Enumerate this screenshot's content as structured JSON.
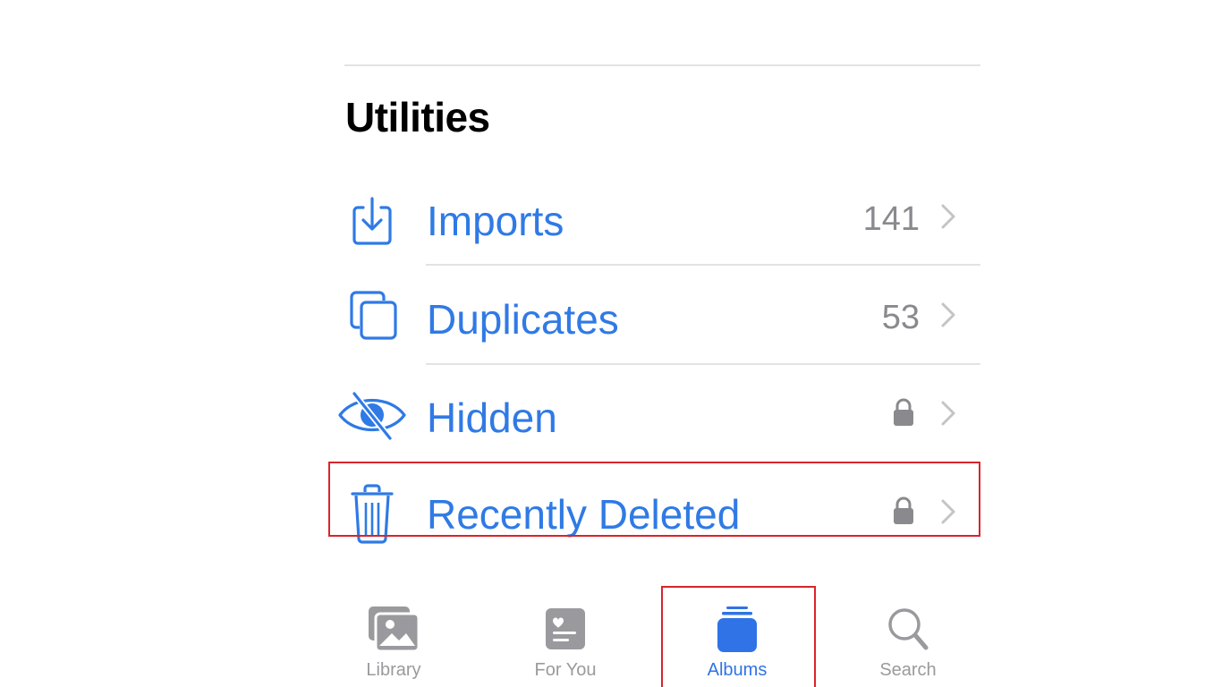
{
  "section": {
    "title": "Utilities"
  },
  "rows": [
    {
      "label": "Imports",
      "icon": "import-icon",
      "count": "141",
      "locked": false
    },
    {
      "label": "Duplicates",
      "icon": "duplicates-icon",
      "count": "53",
      "locked": false
    },
    {
      "label": "Hidden",
      "icon": "eye-slash-icon",
      "count": null,
      "locked": true
    },
    {
      "label": "Recently Deleted",
      "icon": "trash-icon",
      "count": null,
      "locked": true
    }
  ],
  "tabbar": {
    "tabs": [
      {
        "label": "Library",
        "icon": "photo-library-icon",
        "active": false
      },
      {
        "label": "For You",
        "icon": "for-you-icon",
        "active": false
      },
      {
        "label": "Albums",
        "icon": "albums-icon",
        "active": true
      },
      {
        "label": "Search",
        "icon": "search-icon",
        "active": false
      }
    ]
  },
  "colors": {
    "accent": "#2f7ae5",
    "secondary_text": "#8a8a8e",
    "highlight_box": "#d8242c",
    "inactive_tab": "#9a9a9e"
  }
}
